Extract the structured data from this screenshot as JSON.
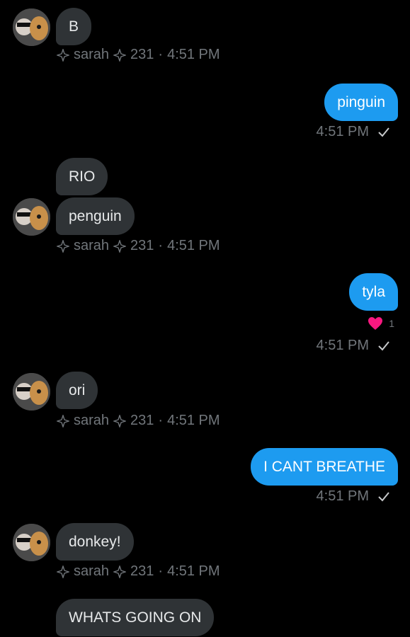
{
  "messages": [
    {
      "dir": "in",
      "text": "B",
      "avatar": true,
      "meta": {
        "name": "sarah",
        "count": "231",
        "time": "4:51 PM"
      }
    },
    {
      "dir": "out",
      "text": "pinguin",
      "time": "4:51 PM"
    },
    {
      "dir": "in",
      "text": "RIO"
    },
    {
      "dir": "in",
      "text": "penguin",
      "avatar": true,
      "meta": {
        "name": "sarah",
        "count": "231",
        "time": "4:51 PM"
      }
    },
    {
      "dir": "out",
      "text": "tyla",
      "reaction": {
        "icon": "heart-icon",
        "count": "1"
      },
      "time": "4:51 PM"
    },
    {
      "dir": "in",
      "text": "ori",
      "avatar": true,
      "meta": {
        "name": "sarah",
        "count": "231",
        "time": "4:51 PM"
      }
    },
    {
      "dir": "out",
      "text": "I CANT BREATHE",
      "time": "4:51 PM"
    },
    {
      "dir": "in",
      "text": "donkey!",
      "avatar": true,
      "meta": {
        "name": "sarah",
        "count": "231",
        "time": "4:51 PM"
      }
    },
    {
      "dir": "in",
      "text": "WHATS GOING ON"
    }
  ],
  "meta_separator": "·",
  "colors": {
    "incoming": "#2f3336",
    "outgoing": "#1d9bf0",
    "meta": "#71767b",
    "heart": "#f91880"
  }
}
